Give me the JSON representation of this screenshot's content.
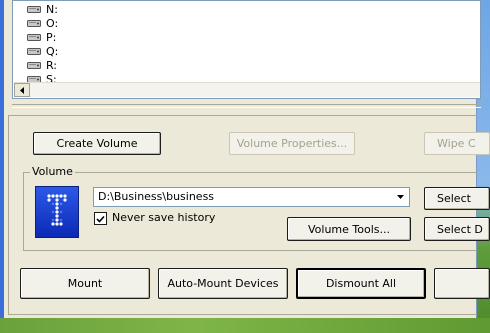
{
  "drives": [
    "N:",
    "O:",
    "P:",
    "Q:",
    "R:",
    "S:"
  ],
  "buttons": {
    "create_volume": "Create Volume",
    "volume_properties": "Volume Properties...",
    "wipe_cache": "Wipe C",
    "select_file": "Select",
    "volume_tools": "Volume Tools...",
    "select_device": "Select D",
    "mount": "Mount",
    "auto_mount": "Auto-Mount Devices",
    "dismount_all": "Dismount All"
  },
  "volume": {
    "group_label": "Volume",
    "path": "D:\\Business\\business",
    "never_save_history_label": "Never save history",
    "never_save_history_checked": true
  },
  "icons": {
    "drive": "hard-drive-icon",
    "logo": "truecrypt-logo-icon",
    "combo_arrow": "chevron-down-icon",
    "scroll_left": "arrow-left-icon"
  }
}
